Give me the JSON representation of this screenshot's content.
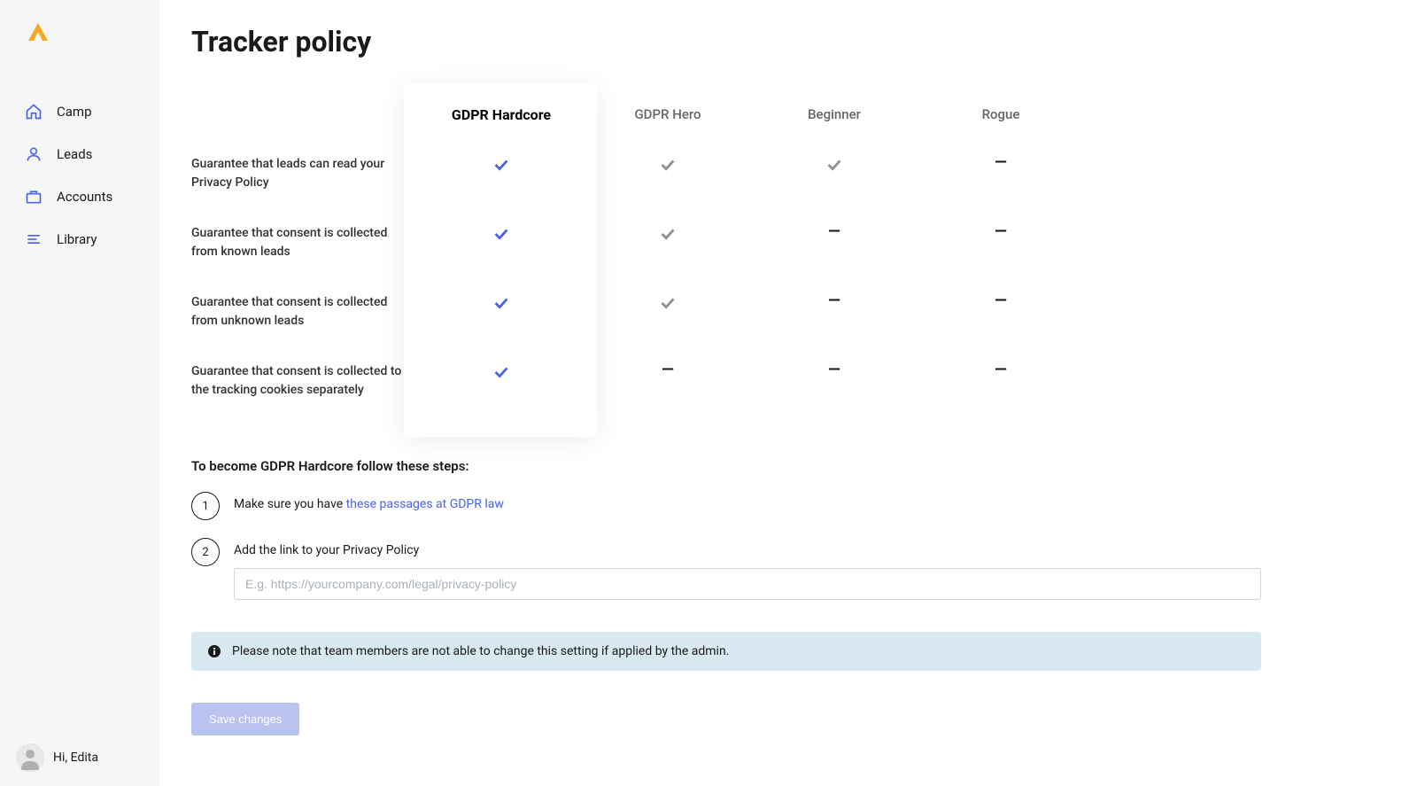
{
  "sidebar": {
    "nav": [
      {
        "label": "Camp"
      },
      {
        "label": "Leads"
      },
      {
        "label": "Accounts"
      },
      {
        "label": "Library"
      }
    ],
    "user_greeting": "Hi, Edita"
  },
  "page": {
    "title": "Tracker policy"
  },
  "policy": {
    "columns": [
      "GDPR Hardcore",
      "GDPR Hero",
      "Beginner",
      "Rogue"
    ],
    "selected_column_index": 0,
    "rows": [
      {
        "label": "Guarantee that leads can read your Privacy Policy",
        "values": [
          "check",
          "check",
          "check",
          "dash"
        ]
      },
      {
        "label": "Guarantee that consent is collected from known leads",
        "values": [
          "check",
          "check",
          "dash",
          "dash"
        ]
      },
      {
        "label": "Guarantee that consent is collected from unknown leads",
        "values": [
          "check",
          "check",
          "dash",
          "dash"
        ]
      },
      {
        "label": "Guarantee that consent is collected to the tracking cookies separately",
        "values": [
          "check",
          "dash",
          "dash",
          "dash"
        ]
      }
    ]
  },
  "steps": {
    "intro": "To become GDPR Hardcore follow these steps:",
    "items": [
      {
        "number": "1",
        "text_prefix": "Make sure you have ",
        "link_text": "these passages at GDPR law"
      },
      {
        "number": "2",
        "text": "Add the link to your Privacy Policy",
        "input_placeholder": "E.g. https://yourcompany.com/legal/privacy-policy"
      }
    ]
  },
  "notice": {
    "text": "Please note that team members are not able to change this setting if applied by the admin."
  },
  "actions": {
    "save_label": "Save changes"
  }
}
